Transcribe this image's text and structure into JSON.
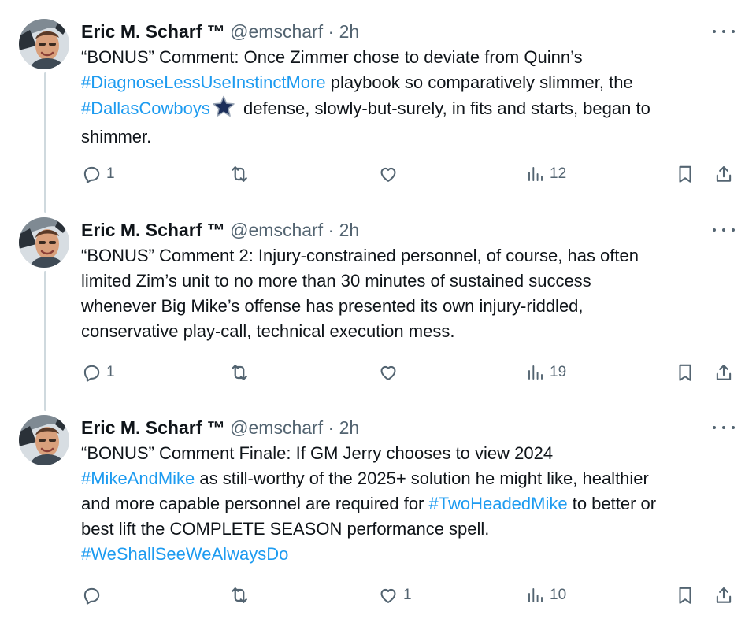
{
  "colors": {
    "link": "#1d9bf0",
    "text": "#0f1419",
    "muted": "#536471",
    "thread_line": "#cfd9de"
  },
  "tweets": [
    {
      "author": {
        "name": "Eric M. Scharf ™",
        "handle": "@emscharf",
        "separator": "·",
        "time": "2h"
      },
      "lines": [
        [
          {
            "t": "“BONUS” Comment: Once Zimmer chose to deviate from Quinn’s"
          }
        ],
        [
          {
            "t": "#DiagnoseLessUseInstinctMore",
            "tag": true
          },
          {
            "t": " playbook so comparatively slimmer, the"
          }
        ],
        [
          {
            "t": "#DallasCowboys",
            "tag": true
          },
          {
            "icon": "cowboys-star-icon"
          },
          {
            "t": " defense, slowly-but-surely, in fits and starts, began to"
          }
        ],
        [
          {
            "t": "shimmer."
          }
        ]
      ],
      "actions": {
        "replies": "1",
        "reposts": "",
        "likes": "",
        "views": "12"
      }
    },
    {
      "author": {
        "name": "Eric M. Scharf ™",
        "handle": "@emscharf",
        "separator": "·",
        "time": "2h"
      },
      "lines": [
        [
          {
            "t": "“BONUS” Comment 2: Injury-constrained personnel, of course, has often"
          }
        ],
        [
          {
            "t": "limited Zim’s unit to no more than 30 minutes of sustained success"
          }
        ],
        [
          {
            "t": "whenever Big Mike’s offense has presented its own injury-riddled,"
          }
        ],
        [
          {
            "t": "conservative play-call, technical execution mess."
          }
        ]
      ],
      "actions": {
        "replies": "1",
        "reposts": "",
        "likes": "",
        "views": "19"
      }
    },
    {
      "author": {
        "name": "Eric M. Scharf ™",
        "handle": "@emscharf",
        "separator": "·",
        "time": "2h"
      },
      "lines": [
        [
          {
            "t": "“BONUS” Comment Finale: If GM Jerry chooses to view 2024"
          }
        ],
        [
          {
            "t": "#MikeAndMike",
            "tag": true
          },
          {
            "t": " as still-worthy of the 2025+ solution he might like, healthier"
          }
        ],
        [
          {
            "t": "and more capable personnel are required for "
          },
          {
            "t": "#TwoHeadedMike",
            "tag": true
          },
          {
            "t": " to better or"
          }
        ],
        [
          {
            "t": "best lift the COMPLETE SEASON performance spell."
          }
        ],
        [
          {
            "t": "#WeShallSeeWeAlwaysDo",
            "tag": true
          }
        ]
      ],
      "actions": {
        "replies": "",
        "reposts": "",
        "likes": "1",
        "views": "10"
      }
    }
  ]
}
